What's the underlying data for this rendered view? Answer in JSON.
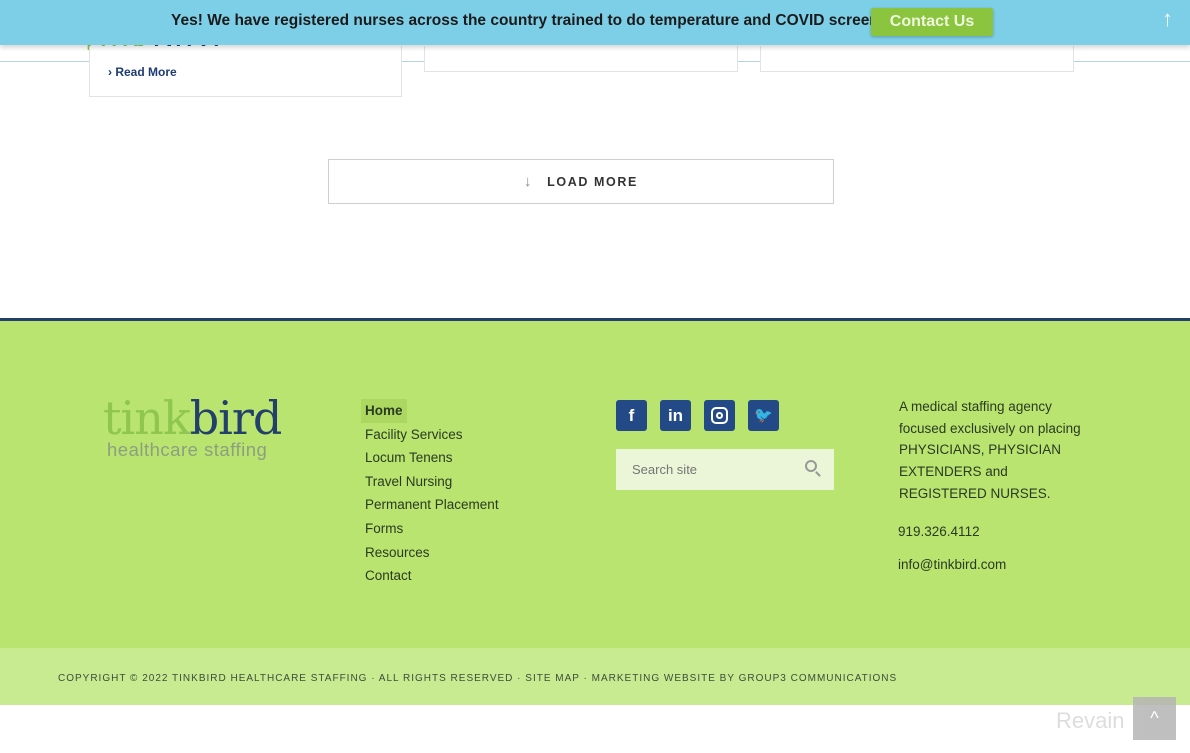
{
  "notice": {
    "text": "Yes! We have registered nurses across the country trained to do temperature and COVID screenings.",
    "button": "Contact Us",
    "up_icon": "arrow-up-icon"
  },
  "header": {
    "logo_part1": "tink",
    "logo_part2": "bird"
  },
  "cards": {
    "read_more": "Read More"
  },
  "load_more": {
    "label": "LOAD MORE",
    "icon": "arrow-down-icon"
  },
  "footer": {
    "logo": {
      "part1": "tink",
      "part2": "bird",
      "tagline": "healthcare staffing"
    },
    "nav": [
      {
        "label": "Home",
        "active": true
      },
      {
        "label": "Facility Services"
      },
      {
        "label": "Locum Tenens"
      },
      {
        "label": "Travel Nursing"
      },
      {
        "label": "Permanent Placement"
      },
      {
        "label": "Forms"
      },
      {
        "label": "Resources"
      },
      {
        "label": "Contact"
      }
    ],
    "social": [
      "facebook",
      "linkedin",
      "instagram",
      "twitter"
    ],
    "search_placeholder": "Search site",
    "about": "A medical staffing agency focused exclusively on placing PHYSICIANS, PHYSICIAN EXTENDERS and REGISTERED NURSES.",
    "phone": "919.326.4112",
    "email": "info@tinkbird.com",
    "copyright": "COPYRIGHT © 2022 TINKBIRD HEALTHCARE STAFFING · ALL RIGHTS RESERVED · SITE MAP · MARKETING WEBSITE BY GROUP3 COMMUNICATIONS"
  },
  "watermark": "Revain",
  "colors": {
    "notice": "#7dcfe7",
    "button": "#8bc43f",
    "footer": "#b9e470",
    "navy": "#23406b"
  }
}
